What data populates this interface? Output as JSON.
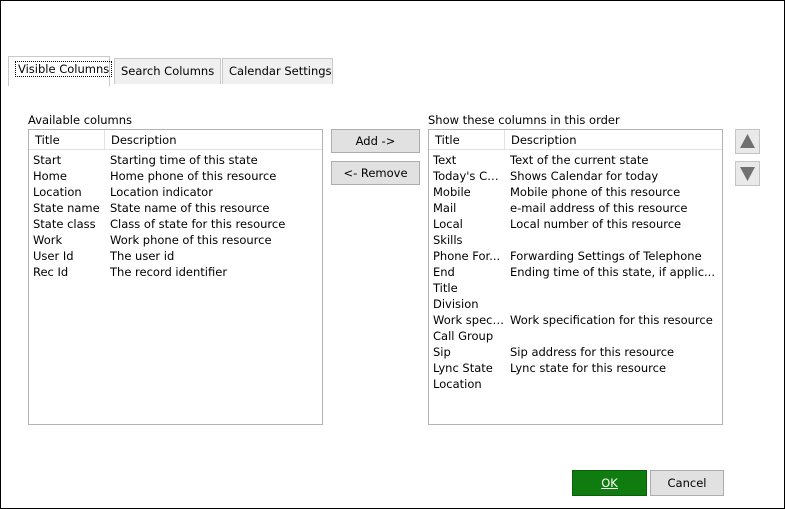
{
  "tabs": [
    {
      "label": "Visible Columns"
    },
    {
      "label": "Search Columns"
    },
    {
      "label": "Calendar Settings"
    }
  ],
  "available": {
    "label": "Available columns",
    "headers": {
      "title": "Title",
      "description": "Description"
    },
    "rows": [
      {
        "title": "Start",
        "description": "Starting time of this state"
      },
      {
        "title": "Home",
        "description": "Home phone of this resource"
      },
      {
        "title": "Location",
        "description": "Location indicator"
      },
      {
        "title": "State name",
        "description": "State name of this resource"
      },
      {
        "title": "State class",
        "description": "Class of state for this resource"
      },
      {
        "title": "Work",
        "description": "Work phone of this resource"
      },
      {
        "title": "User Id",
        "description": "The user id"
      },
      {
        "title": "Rec Id",
        "description": "The record identifier"
      }
    ]
  },
  "shown": {
    "label": "Show these columns in this order",
    "headers": {
      "title": "Title",
      "description": "Description"
    },
    "rows": [
      {
        "title": "Text",
        "description": "Text of the current state"
      },
      {
        "title": "Today's Ca...",
        "description": "Shows Calendar for today"
      },
      {
        "title": "Mobile",
        "description": "Mobile phone of this resource"
      },
      {
        "title": "Mail",
        "description": "e-mail address of this resource"
      },
      {
        "title": "Local",
        "description": "Local number of this resource"
      },
      {
        "title": "Skills",
        "description": ""
      },
      {
        "title": "Phone For...",
        "description": "Forwarding Settings of Telephone"
      },
      {
        "title": "End",
        "description": "Ending time of this state, if applic..."
      },
      {
        "title": "Title",
        "description": ""
      },
      {
        "title": "Division",
        "description": ""
      },
      {
        "title": "Work speci...",
        "description": "Work specification for this resource"
      },
      {
        "title": "Call Group",
        "description": ""
      },
      {
        "title": "Sip",
        "description": "Sip address for this resource"
      },
      {
        "title": "Lync State",
        "description": "Lync state for this resource"
      },
      {
        "title": "Location",
        "description": ""
      }
    ]
  },
  "buttons": {
    "add": "Add ->",
    "remove": "<- Remove",
    "ok": "OK",
    "cancel": "Cancel"
  },
  "icons": {
    "move_up": "triangle-up-icon",
    "move_down": "triangle-down-icon"
  },
  "colors": {
    "ok_background": "#107c10",
    "arrow_fill": "#707070"
  }
}
